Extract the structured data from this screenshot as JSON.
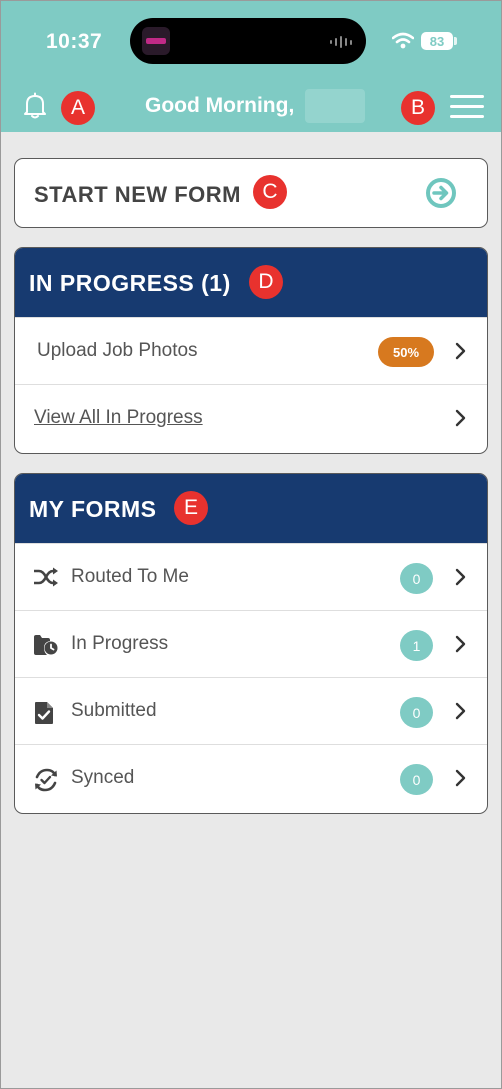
{
  "status": {
    "time": "10:37",
    "battery": "83"
  },
  "header": {
    "greeting": "Good Morning,"
  },
  "markers": {
    "a": "A",
    "b": "B",
    "c": "C",
    "d": "D",
    "e": "E"
  },
  "start_form": {
    "label": "START NEW FORM",
    "icon": "arrow-circle-right-icon"
  },
  "in_progress": {
    "title": "IN PROGRESS (1)",
    "items": [
      {
        "label": "Upload Job Photos",
        "badge": "50%",
        "progress": 0.5
      }
    ],
    "view_all": "View All In Progress"
  },
  "my_forms": {
    "title": "MY FORMS",
    "items": [
      {
        "label": "Routed To Me",
        "count": "0",
        "icon": "shuffle-icon"
      },
      {
        "label": "In Progress",
        "count": "1",
        "icon": "folder-clock-icon"
      },
      {
        "label": "Submitted",
        "count": "0",
        "icon": "document-check-icon"
      },
      {
        "label": "Synced",
        "count": "0",
        "icon": "sync-check-icon"
      }
    ]
  },
  "colors": {
    "header_bg": "#7fcbc4",
    "section_header": "#173a70",
    "badge_orange": "#d7791f",
    "count_teal": "#7fcbc4",
    "marker_red": "#e8322e"
  }
}
